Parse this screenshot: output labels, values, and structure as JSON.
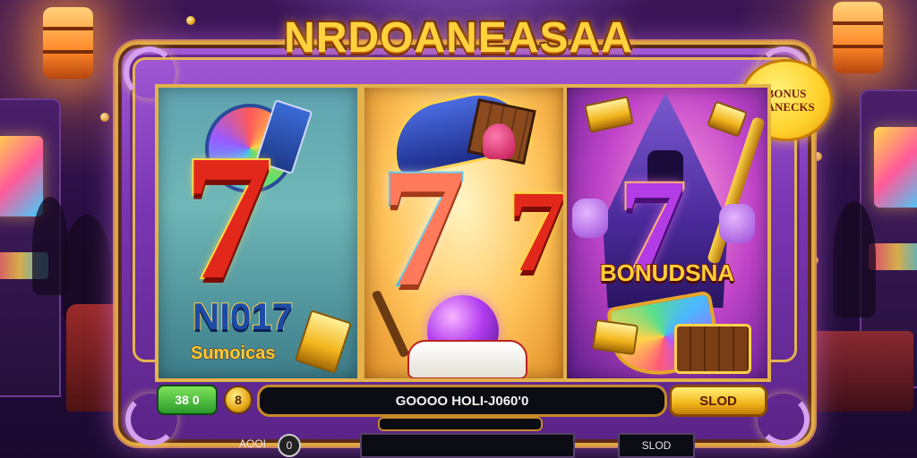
{
  "game": {
    "title": "NRDOANEASAA",
    "bonus_bubble": {
      "line1": "BONUS",
      "line2": "CANECKS"
    }
  },
  "reels": [
    {
      "symbol": "7",
      "text_big": "NI017",
      "text_small": "Sumoicas"
    },
    {
      "symbol": "7"
    },
    {
      "symbol": "7",
      "banner": "BONUDSNA"
    }
  ],
  "controls": {
    "credit_box": "38 0",
    "coin_label": "8",
    "message": "GOOOO HOLI-J060'0",
    "slot_button": "SLOD"
  },
  "bottom_bar": {
    "left_label": "AOOI",
    "info_icon": "0",
    "right_label": "SLOD"
  },
  "colors": {
    "frame_purple": "#7a36b3",
    "gold_trim": "#e0a640",
    "title_gold": "#ffd23d",
    "credit_green": "#2a9a2a",
    "slot_button_yellow": "#f2b519"
  },
  "icons": [
    "coin-icon",
    "info-icon",
    "lamp-icon"
  ]
}
